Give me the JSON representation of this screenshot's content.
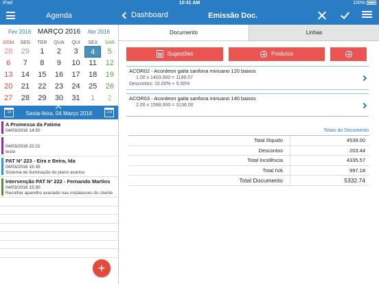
{
  "status": {
    "left": "iPad",
    "time": "10:41 AM",
    "battery": "100%"
  },
  "left_nav": {
    "title": "Agenda"
  },
  "right_nav": {
    "back_label": "Dashboard",
    "title": "Emissão Doc."
  },
  "calendar": {
    "prev_month": "Fev 2016",
    "current_month": "MARÇO 2016",
    "next_month": "Abr 2016",
    "weekdays": [
      "DOM",
      "SEG",
      "TER",
      "QUA",
      "QUI",
      "SEX",
      "SAB"
    ],
    "weeks": [
      [
        "28",
        "29",
        "1",
        "2",
        "3",
        "4",
        "5"
      ],
      [
        "6",
        "7",
        "8",
        "9",
        "10",
        "11",
        "12"
      ],
      [
        "13",
        "14",
        "15",
        "16",
        "17",
        "18",
        "19"
      ],
      [
        "20",
        "21",
        "22",
        "23",
        "24",
        "25",
        "26"
      ],
      [
        "27",
        "28",
        "29",
        "30",
        "31",
        "1",
        "2"
      ]
    ],
    "selected_day": "4",
    "date_label": "Sexta-feira, 04 Março 2016",
    "minus_label": "-14",
    "plus_label": "+14"
  },
  "events": [
    {
      "title": "A Promessa da Fatima",
      "date": "04/03/2016 14:50",
      "extra": "",
      "color": "#8b2fa8"
    },
    {
      "title": "",
      "date": "04/03/2016 22:21",
      "extra": "teste",
      "color": "#8b2fa8"
    },
    {
      "title": "PAT Nº 223 - Eira e Beira, lda",
      "date": "04/03/2016 15:35",
      "extra": "Sistema de iluminação do piano avariou",
      "color": "#1e9bd7"
    },
    {
      "title": "Intervenção PAT Nº 222 - Fernando Martins",
      "date": "04/03/2016 15:30",
      "extra": "Recolher aparelho avariado nas instalacoes do cliente",
      "color": "#5a8a3a"
    }
  ],
  "fab_label": "+",
  "tabs": [
    {
      "label": "Documento"
    },
    {
      "label": "Linhas"
    }
  ],
  "actions": {
    "suggestions": "Sugestões",
    "products": "Produtos"
  },
  "lines": [
    {
      "name": "ACOR02 - Acordeon gaita sanfona minuano 120 baixos",
      "calc": "1.00 x 1403.000 = 1199.57",
      "discount": "Descontos: 10.00% + 5.00%"
    },
    {
      "name": "ACOR03 - Acordeon gaita sanfona minuano 140 baixos",
      "calc": "2.00 x 1568.000 = 3136.00",
      "discount": ""
    }
  ],
  "totals": {
    "header": "Totais do Documento",
    "rows": [
      {
        "label": "Total Ilíquido",
        "value": "4539.00"
      },
      {
        "label": "Descontos",
        "value": "203.44"
      },
      {
        "label": "Total Incidência",
        "value": "4335.57"
      },
      {
        "label": "Total IVA",
        "value": "997.18"
      },
      {
        "label": "Total Documento",
        "value": "5332.74"
      }
    ]
  },
  "colors": {
    "primary": "#2a7cc4",
    "action": "#ea5551",
    "sunday": "#e2433f",
    "saturday": "#5aa93a"
  }
}
